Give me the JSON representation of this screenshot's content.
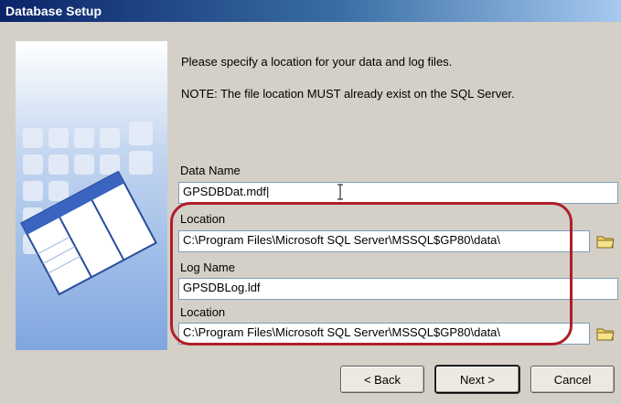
{
  "window": {
    "title": "Database Setup"
  },
  "instructions": {
    "line1": "Please specify a location for your data and log files.",
    "line2": "NOTE: The file location MUST already exist on the SQL Server."
  },
  "fields": {
    "data_name": {
      "label": "Data Name",
      "value": "GPSDBDat.mdf|"
    },
    "data_location": {
      "label": "Location",
      "value": "C:\\Program Files\\Microsoft SQL Server\\MSSQL$GP80\\data\\"
    },
    "log_name": {
      "label": "Log Name",
      "value": "GPSDBLog.ldf"
    },
    "log_location": {
      "label": "Location",
      "value": "C:\\Program Files\\Microsoft SQL Server\\MSSQL$GP80\\data\\"
    }
  },
  "buttons": {
    "back": "< Back",
    "next": "Next >",
    "cancel": "Cancel"
  },
  "icons": {
    "browse": "folder-icon",
    "graphic": "database-table-icon"
  },
  "colors": {
    "title_bar": "#0a246a",
    "highlight": "#b01e2a",
    "dialog": "#d4d0c8"
  }
}
